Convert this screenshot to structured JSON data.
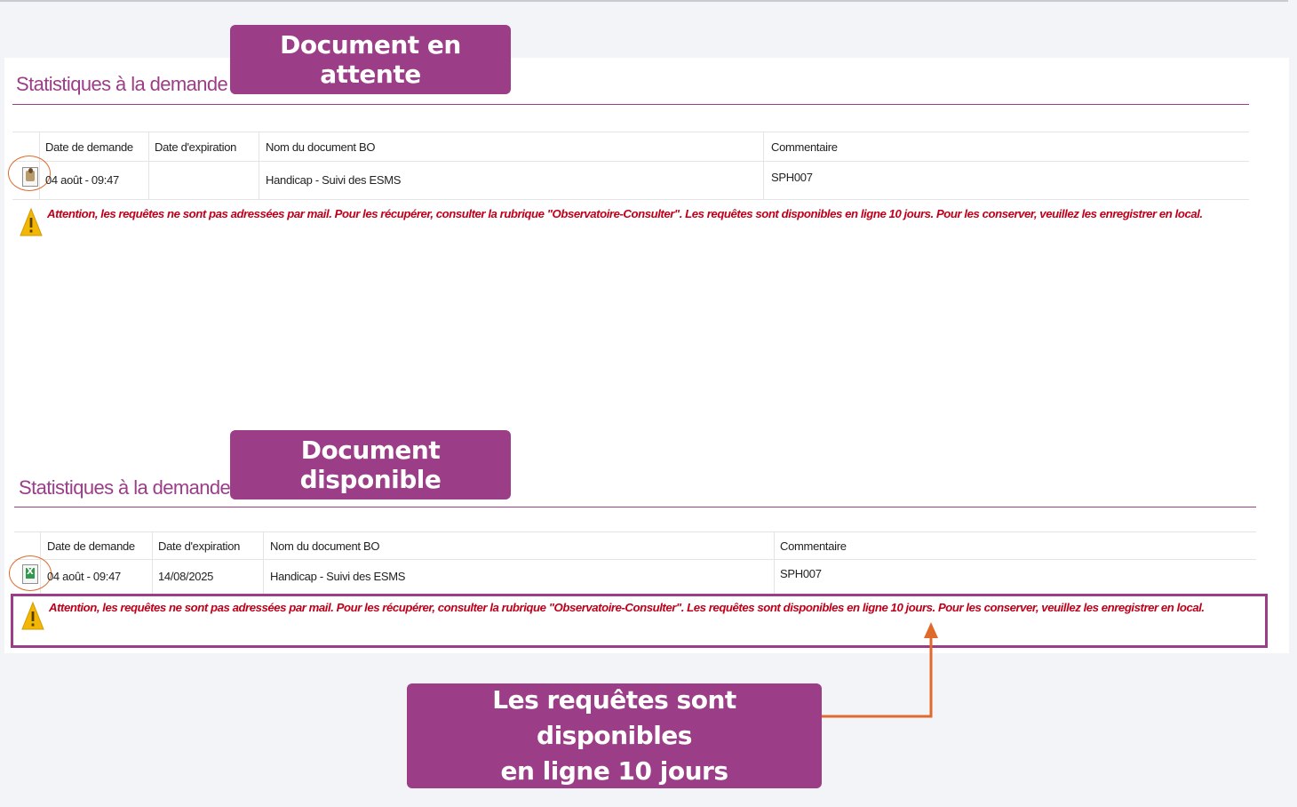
{
  "callouts": {
    "pending": "Document en attente",
    "available": "Document disponible",
    "note_line1": "Les requêtes sont disponibles",
    "note_line2": "en ligne 10 jours"
  },
  "sections": [
    {
      "title": "Statistiques à la demande",
      "headers": [
        "Date de demande",
        "Date d'expiration",
        "Nom du document BO",
        "Commentaire"
      ],
      "row": {
        "status_icon": "pending-document-icon",
        "date_demande": "04 août - 09:47",
        "date_expiration": "",
        "nom_document": "Handicap - Suivi des ESMS",
        "commentaire": "SPH007"
      },
      "warning": "Attention, les requêtes ne sont pas adressées par mail. Pour les récupérer, consulter la rubrique \"Observatoire-Consulter\". Les requêtes sont disponibles en ligne 10 jours. Pour les conserver, veuillez les enregistrer en local."
    },
    {
      "title": "Statistiques à la demande",
      "headers": [
        "Date de demande",
        "Date d'expiration",
        "Nom du document BO",
        "Commentaire"
      ],
      "row": {
        "status_icon": "excel-document-icon",
        "date_demande": "04 août - 09:47",
        "date_expiration": "14/08/2025",
        "nom_document": "Handicap - Suivi des ESMS",
        "commentaire": "SPH007"
      },
      "warning": "Attention, les requêtes ne sont pas adressées par mail. Pour les récupérer, consulter la rubrique \"Observatoire-Consulter\". Les requêtes sont disponibles en ligne 10 jours. Pour les conserver, veuillez les enregistrer en local."
    }
  ],
  "colors": {
    "accent": "#9b3d87",
    "warning_text": "#c0001a",
    "warning_icon": "#f2b705",
    "annotation_orange": "#e06a2b"
  }
}
